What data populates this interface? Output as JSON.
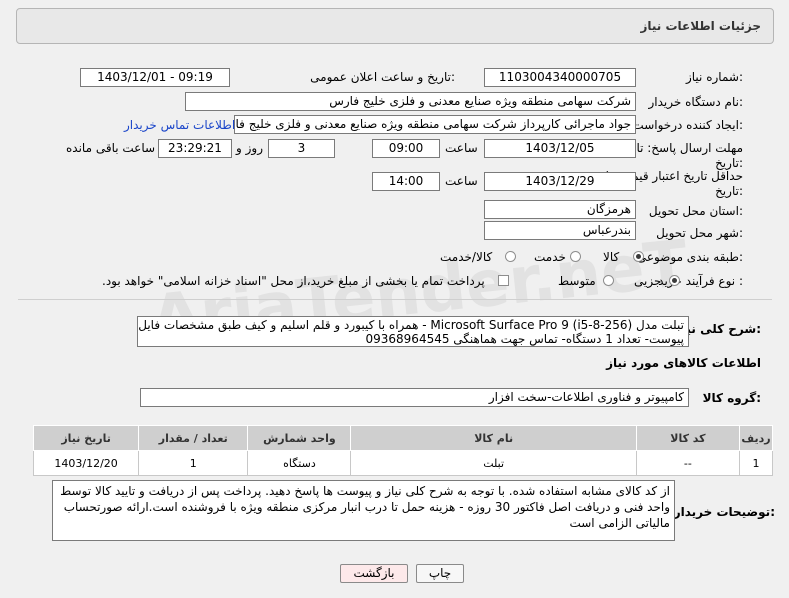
{
  "header": {
    "title": "جزئیات اطلاعات نیاز"
  },
  "form": {
    "need_number_label": "شماره نیاز:",
    "need_number": "1103004340000705",
    "announce_label": "تاریخ و ساعت اعلان عمومی:",
    "announce_value": "1403/12/01 - 09:19",
    "buyer_org_label": "نام دستگاه خریدار:",
    "buyer_org": "شرکت سهامی منطقه ویژه صنایع معدنی و فلزی خلیج فارس",
    "requester_label": "ایجاد کننده درخواست:",
    "requester": "جواد ماجرائی کارپرداز شرکت سهامی منطقه ویژه صنایع معدنی و فلزی خلیج فار",
    "buyer_contact_link": "اطلاعات تماس خریدار",
    "deadline_label_1": "مهلت ارسال پاسخ: تا",
    "deadline_label_2": "تاریخ:",
    "deadline_date": "1403/12/05",
    "time_label": "ساعت",
    "deadline_time": "09:00",
    "days_value": "3",
    "days_label": "روز و",
    "remaining_time": "23:29:21",
    "remaining_label": "ساعت باقی مانده",
    "min_validity_label_1": "حداقل تاریخ اعتبار قیمت: تا",
    "min_validity_label_2": "تاریخ:",
    "validity_date": "1403/12/29",
    "validity_time": "14:00",
    "province_label": "استان محل تحویل:",
    "province": "هرمزگان",
    "city_label": "شهر محل تحویل:",
    "city": "بندرعباس",
    "category_label": "طبقه بندی موضوعی:",
    "category_options": [
      "کالا",
      "خدمت",
      "کالا/خدمت"
    ],
    "category_selected": "کالا",
    "process_label": "نوع فرآیند خرید :",
    "process_options": [
      "جزیی",
      "متوسط"
    ],
    "process_selected": "جزیی",
    "payment_note": "پرداخت تمام یا بخشی از مبلغ خرید،از محل \"اسناد خزانه اسلامی\" خواهد بود."
  },
  "description": {
    "label": "شرح کلی نیاز:",
    "line1": "تبلت مدل Microsoft Surface Pro 9 (i5-8-256) - همراه با کیبورد و قلم اسلیم و کیف طبق مشخصات فایل",
    "line2": "پیوست- تعداد 1 دستگاه- تماس جهت هماهنگی 09368964545"
  },
  "goods_info_title": "اطلاعات کالاهای مورد نیاز",
  "goods_group": {
    "label": "گروه کالا:",
    "value": "کامپیوتر و فناوری اطلاعات-سخت افزار"
  },
  "table": {
    "headers": [
      "ردیف",
      "کد کالا",
      "نام کالا",
      "واحد شمارش",
      "تعداد / مقدار",
      "تاریخ نیاز"
    ],
    "rows": [
      [
        "1",
        "--",
        "تبلت",
        "دستگاه",
        "1",
        "1403/12/20"
      ]
    ]
  },
  "buyer_notes": {
    "label": "توضیحات خریدار:",
    "line1": "از کد کالای مشابه استفاده شده. با توجه به شرح کلی نیاز و پیوست ها پاسخ دهید. پرداخت پس از دریافت و تایید کالا  توسط",
    "line2": "واحد فنی و دریافت اصل فاکتور  30 روزه - هزینه حمل تا درب انبار مرکزی منطقه ویژه با فروشنده است.ارائه صورتحساب",
    "line3": "مالیاتی الزامی است"
  },
  "buttons": {
    "print": "چاپ",
    "back": "بازگشت"
  },
  "watermark": "AriaTender.neT",
  "colors": {
    "link": "#1a45c9",
    "back_button_bg": "#fde9ea",
    "table_header": "#cfcfcf"
  }
}
